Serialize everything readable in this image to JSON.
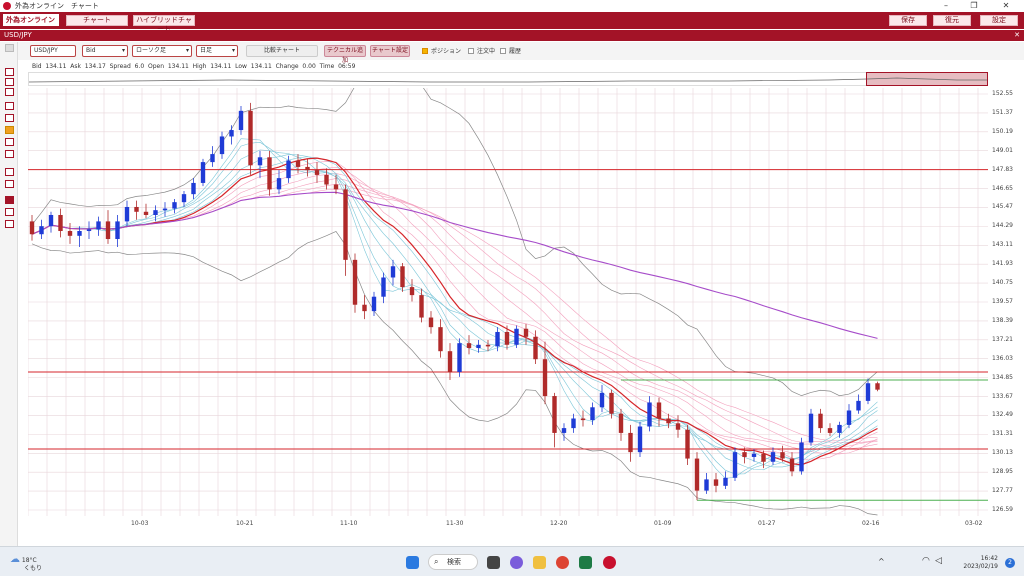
{
  "window": {
    "title": "外為オンライン　チャート"
  },
  "menu": {
    "logo": "外為オンライン",
    "chart_tab": "チャート",
    "hybrid_tab": "ハイブリッドチャート",
    "save": "保存",
    "restore": "復元",
    "settings": "設定"
  },
  "pane": {
    "title": "USD/JPY"
  },
  "toolbar": {
    "pair": "USD/JPY",
    "price_type": "Bid",
    "chart_type": "ローソク足",
    "interval": "日足",
    "compare": "比較チャート",
    "add_technical": "テクニカル追加",
    "chart_settings": "チャート設定",
    "position": "ポジション",
    "orders": "注文中",
    "history": "履歴"
  },
  "quote": {
    "bid_label": "Bid",
    "bid": "134.11",
    "ask_label": "Ask",
    "ask": "134.17",
    "spread_label": "Spread",
    "spread": "6.0",
    "open_label": "Open",
    "open": "134.11",
    "high_label": "High",
    "high": "134.11",
    "low_label": "Low",
    "low": "134.11",
    "change_label": "Change",
    "change": "0.00",
    "time_label": "Time",
    "time": "06:59"
  },
  "y_ticks": [
    "152.55",
    "151.37",
    "150.19",
    "149.01",
    "147.83",
    "146.65",
    "145.47",
    "144.29",
    "143.11",
    "141.93",
    "140.75",
    "139.57",
    "138.39",
    "137.21",
    "136.03",
    "134.85",
    "133.67",
    "132.49",
    "131.31",
    "130.13",
    "128.95",
    "127.77",
    "126.59"
  ],
  "x_ticks": [
    "10-03",
    "10-21",
    "11-10",
    "11-30",
    "12-20",
    "01-09",
    "01-27",
    "02-16",
    "03-02"
  ],
  "chart_data": {
    "type": "candlestick",
    "instrument": "USD/JPY",
    "interval": "日足",
    "ylim": [
      126.59,
      152.55
    ],
    "horizontal_lines": [
      147.83,
      135.2,
      130.4
    ],
    "green_lines": [
      134.7,
      127.2
    ],
    "ohlc": [
      [
        144.6,
        145.0,
        143.4,
        143.8
      ],
      [
        143.8,
        144.7,
        143.5,
        144.3
      ],
      [
        144.3,
        145.2,
        143.9,
        145.0
      ],
      [
        145.0,
        145.4,
        143.6,
        144.0
      ],
      [
        144.0,
        144.5,
        143.2,
        143.7
      ],
      [
        143.7,
        144.3,
        143.0,
        144.0
      ],
      [
        144.0,
        144.6,
        143.5,
        144.1
      ],
      [
        144.1,
        144.9,
        143.7,
        144.6
      ],
      [
        144.6,
        145.3,
        143.2,
        143.5
      ],
      [
        143.5,
        145.0,
        143.0,
        144.6
      ],
      [
        144.6,
        145.9,
        144.3,
        145.5
      ],
      [
        145.5,
        145.9,
        144.7,
        145.2
      ],
      [
        145.2,
        145.7,
        144.8,
        145.0
      ],
      [
        145.0,
        145.6,
        144.6,
        145.3
      ],
      [
        145.3,
        145.8,
        144.9,
        145.4
      ],
      [
        145.4,
        146.0,
        145.1,
        145.8
      ],
      [
        145.8,
        146.5,
        145.5,
        146.3
      ],
      [
        146.3,
        147.3,
        146.0,
        147.0
      ],
      [
        147.0,
        148.5,
        146.8,
        148.3
      ],
      [
        148.3,
        149.3,
        148.0,
        148.8
      ],
      [
        148.8,
        150.2,
        148.5,
        149.9
      ],
      [
        149.9,
        150.6,
        149.4,
        150.3
      ],
      [
        150.3,
        151.8,
        150.0,
        151.5
      ],
      [
        151.5,
        152.0,
        147.5,
        148.1
      ],
      [
        148.1,
        149.0,
        147.3,
        148.6
      ],
      [
        148.6,
        149.0,
        146.2,
        146.6
      ],
      [
        146.6,
        147.8,
        146.3,
        147.3
      ],
      [
        147.3,
        148.7,
        147.0,
        148.4
      ],
      [
        148.4,
        148.8,
        147.6,
        148.0
      ],
      [
        148.0,
        148.5,
        147.4,
        147.8
      ],
      [
        147.8,
        148.3,
        147.0,
        147.5
      ],
      [
        147.5,
        147.9,
        146.6,
        146.9
      ],
      [
        146.9,
        147.5,
        146.3,
        146.6
      ],
      [
        146.6,
        146.9,
        141.2,
        142.2
      ],
      [
        142.2,
        142.6,
        138.9,
        139.4
      ],
      [
        139.4,
        140.0,
        138.5,
        139.0
      ],
      [
        139.0,
        140.2,
        138.7,
        139.9
      ],
      [
        139.9,
        141.4,
        139.5,
        141.1
      ],
      [
        141.1,
        142.2,
        140.6,
        141.8
      ],
      [
        141.8,
        142.0,
        140.2,
        140.5
      ],
      [
        140.5,
        141.0,
        139.6,
        140.0
      ],
      [
        140.0,
        140.4,
        138.3,
        138.6
      ],
      [
        138.6,
        139.0,
        137.6,
        138.0
      ],
      [
        138.0,
        138.5,
        136.1,
        136.5
      ],
      [
        136.5,
        137.0,
        134.7,
        135.2
      ],
      [
        135.2,
        137.3,
        134.9,
        137.0
      ],
      [
        137.0,
        137.5,
        136.3,
        136.7
      ],
      [
        136.7,
        137.2,
        136.4,
        136.9
      ],
      [
        136.9,
        137.2,
        136.5,
        136.8
      ],
      [
        136.8,
        138.0,
        136.5,
        137.7
      ],
      [
        137.7,
        138.1,
        136.6,
        136.9
      ],
      [
        136.9,
        138.1,
        136.7,
        137.9
      ],
      [
        137.9,
        138.2,
        136.9,
        137.4
      ],
      [
        137.4,
        137.8,
        135.7,
        136.0
      ],
      [
        136.0,
        137.1,
        133.2,
        133.7
      ],
      [
        133.7,
        133.9,
        130.5,
        131.4
      ],
      [
        131.4,
        132.0,
        130.9,
        131.7
      ],
      [
        131.7,
        132.6,
        131.4,
        132.3
      ],
      [
        132.3,
        132.8,
        131.8,
        132.2
      ],
      [
        132.2,
        133.3,
        131.9,
        133.0
      ],
      [
        133.0,
        134.4,
        132.7,
        133.9
      ],
      [
        133.9,
        134.1,
        132.3,
        132.6
      ],
      [
        132.6,
        132.9,
        130.9,
        131.4
      ],
      [
        131.4,
        131.9,
        129.6,
        130.2
      ],
      [
        130.2,
        132.1,
        129.9,
        131.8
      ],
      [
        131.8,
        133.7,
        131.5,
        133.3
      ],
      [
        133.3,
        133.6,
        131.8,
        132.3
      ],
      [
        132.3,
        132.6,
        131.7,
        132.0
      ],
      [
        132.0,
        132.5,
        131.1,
        131.6
      ],
      [
        131.6,
        131.9,
        129.4,
        129.8
      ],
      [
        129.8,
        130.2,
        127.2,
        127.8
      ],
      [
        127.8,
        128.9,
        127.6,
        128.5
      ],
      [
        128.5,
        128.9,
        127.7,
        128.1
      ],
      [
        128.1,
        129.0,
        127.9,
        128.6
      ],
      [
        128.6,
        130.5,
        128.4,
        130.2
      ],
      [
        130.2,
        130.5,
        129.5,
        129.9
      ],
      [
        129.9,
        130.4,
        129.6,
        130.1
      ],
      [
        130.1,
        130.3,
        129.2,
        129.6
      ],
      [
        129.6,
        130.5,
        129.4,
        130.2
      ],
      [
        130.2,
        130.6,
        129.6,
        129.8
      ],
      [
        129.8,
        130.2,
        128.7,
        129.0
      ],
      [
        129.0,
        131.1,
        128.8,
        130.8
      ],
      [
        130.8,
        132.9,
        130.6,
        132.6
      ],
      [
        132.6,
        132.9,
        131.4,
        131.7
      ],
      [
        131.7,
        132.0,
        131.2,
        131.4
      ],
      [
        131.4,
        132.1,
        131.1,
        131.9
      ],
      [
        131.9,
        133.2,
        131.7,
        132.8
      ],
      [
        132.8,
        133.8,
        132.6,
        133.4
      ],
      [
        133.4,
        134.8,
        133.2,
        134.5
      ],
      [
        134.5,
        134.6,
        134.0,
        134.1
      ]
    ]
  },
  "taskbar": {
    "temp": "18°C",
    "weather": "くもり",
    "search": "検索",
    "time": "16:42",
    "date": "2023/02/19",
    "notif": "2"
  }
}
